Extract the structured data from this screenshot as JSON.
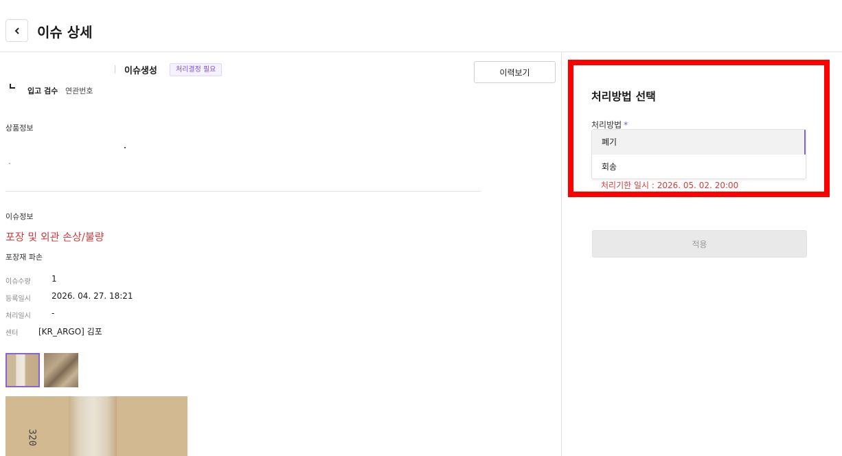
{
  "header": {
    "title": "이슈 상세"
  },
  "summary": {
    "status": "이슈생성",
    "badge": "처리결정 필요",
    "history_button": "이력보기",
    "inbound": "입고 검수",
    "related_number_label": "연관번호"
  },
  "product": {
    "title": "상품정보"
  },
  "issue": {
    "title": "이슈정보",
    "type": "포장 및 외관 손상/불량",
    "subtype": "포장재 파손",
    "rows": [
      {
        "label": "이슈수량",
        "value": "1"
      },
      {
        "label": "등록일시",
        "value": "2026. 04. 27. 18:21"
      },
      {
        "label": "처리일시",
        "value": "-"
      },
      {
        "label": "센터",
        "value": "[KR_ARGO] 김포"
      }
    ],
    "photo_text": "320"
  },
  "panel": {
    "title": "처리방법 선택",
    "method_label": "처리방법",
    "required_mark": "*",
    "options": [
      "폐기",
      "회송"
    ],
    "deadline": "처리기한 일시 : 2026. 05. 02. 20:00",
    "apply_button": "적용"
  },
  "colors": {
    "accent": "#7b4fd6",
    "alert": "#d23c3c",
    "highlight_border": "#ff0000"
  },
  "icons": {
    "back": "chevron-left-icon"
  }
}
